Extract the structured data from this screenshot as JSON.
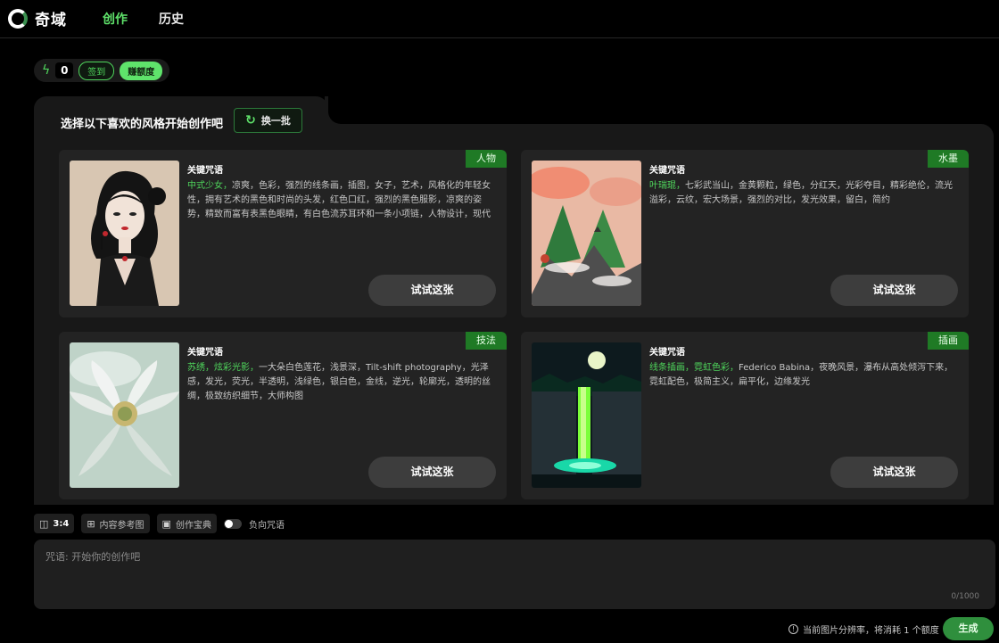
{
  "app": {
    "name": "奇域"
  },
  "nav": {
    "create": "创作",
    "history": "历史"
  },
  "credits": {
    "count": "0",
    "checkin_label": "签到",
    "earn_label": "赚额度"
  },
  "panel": {
    "title": "选择以下喜欢的风格开始创作吧",
    "refresh_label": "换一批"
  },
  "cards": [
    {
      "tag": "人物",
      "label": "关键咒语",
      "highlight": "中式少女，",
      "text": "凉爽，色彩，强烈的线条画，插图，女子，艺术，风格化的年轻女性，拥有艺术的黑色和时尚的头发，红色口红，强烈的黑色服影，凉爽的姿势，精致而富有表黑色眼睛，有白色流苏耳环和一条小项链，人物设计，现代",
      "button": "试试这张"
    },
    {
      "tag": "水墨",
      "label": "关键咒语",
      "highlight": "叶瑞琨，",
      "text": "七彩武当山，金黄颗粒，绿色，分红天，光彩夺目，精彩绝伦，流光溢彩，云纹，宏大场景，强烈的对比，发光效果，留白，简约",
      "button": "试试这张"
    },
    {
      "tag": "技法",
      "label": "关键咒语",
      "highlight": "苏绣，炫彩光影，",
      "text": "一大朵白色莲花，浅景深，Tilt-shift photography，光泽感，发光，荧光，半透明，浅绿色，银白色，金线，逆光，轮廓光，透明的丝绸，极致纺织细节，大师构图",
      "button": "试试这张"
    },
    {
      "tag": "插画",
      "label": "关键咒语",
      "highlight": "线条插画，霓虹色彩，",
      "text": "Federico Babina，夜晚风景，瀑布从高处倾泻下来，霓虹配色，极简主义，扁平化，边缘发光",
      "button": "试试这张"
    }
  ],
  "toolbar": {
    "ratio": "3:4",
    "ref_image": "内容参考图",
    "guide": "创作宝典",
    "negative": "负向咒语"
  },
  "prompt": {
    "placeholder": "咒语: 开始你的创作吧",
    "counter": "0/1000"
  },
  "footer": {
    "note": "当前图片分辨率，将消耗 1 个额度",
    "generate": "生成"
  },
  "colors": {
    "accent": "#5fe36b",
    "tag": "#1f7a25",
    "panel": "#181818",
    "card": "#232323"
  }
}
